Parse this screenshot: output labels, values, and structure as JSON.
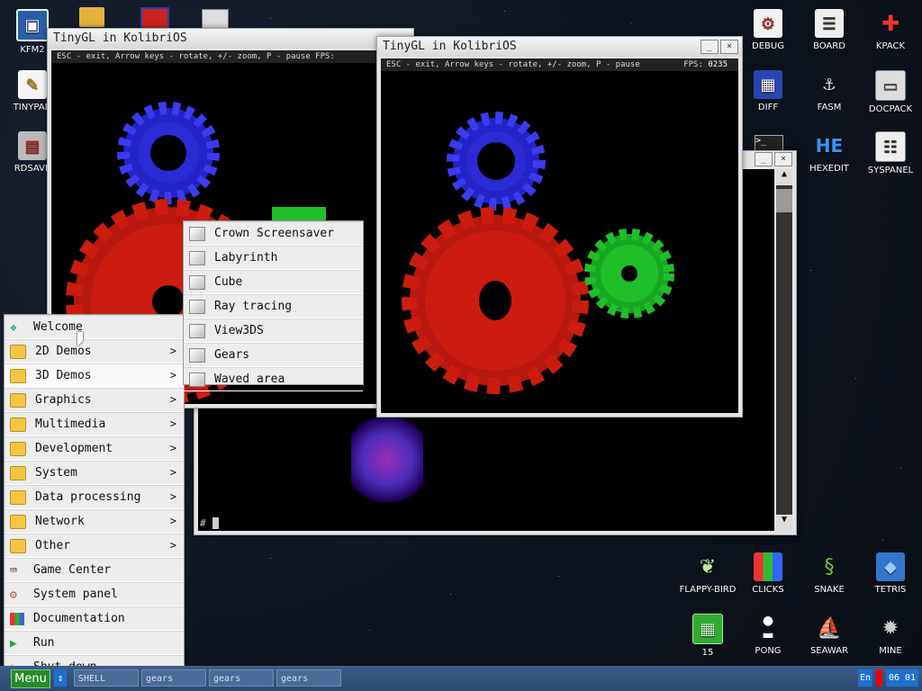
{
  "desktop_icons_left": [
    {
      "label": "KFM2",
      "icon": "floppy-icon"
    },
    {
      "label": "TINYPAD",
      "icon": "notepad-icon"
    },
    {
      "label": "RDSAVE",
      "icon": "ramdisk-icon"
    }
  ],
  "desktop_icons_right": [
    {
      "label": "DEBUG",
      "icon": "debug-icon"
    },
    {
      "label": "BOARD",
      "icon": "board-icon"
    },
    {
      "label": "KPACK",
      "icon": "wrench-icon"
    },
    {
      "label": "DIFF",
      "icon": "diff-icon"
    },
    {
      "label": "FASM",
      "icon": "fasm-icon"
    },
    {
      "label": "DOCPACK",
      "icon": "docpack-icon"
    },
    {
      "label": "HEXEDIT",
      "icon": "hexedit-icon"
    },
    {
      "label": "SYSPANEL",
      "icon": "syspanel-icon"
    }
  ],
  "desktop_icons_games": [
    {
      "label": "FLAPPY-BIRD",
      "icon": "bird-icon"
    },
    {
      "label": "CLICKS",
      "icon": "clicks-icon"
    },
    {
      "label": "SNAKE",
      "icon": "snake-icon"
    },
    {
      "label": "TETRIS",
      "icon": "tetris-icon"
    },
    {
      "label": "15",
      "icon": "puzzle15-icon"
    },
    {
      "label": "PONG",
      "icon": "pong-icon"
    },
    {
      "label": "SEAWAR",
      "icon": "ship-icon"
    },
    {
      "label": "MINE",
      "icon": "mine-icon"
    }
  ],
  "window1": {
    "title": "TinyGL in KolibriOS",
    "info": "ESC - exit, Arrow keys - rotate, +/- zoom, P - pause   FPS:"
  },
  "window2": {
    "title": "TinyGL in KolibriOS",
    "info": "ESC - exit, Arrow keys - rotate, +/- zoom, P - pause",
    "fps_label": "FPS:",
    "fps_value": "0235"
  },
  "shell": {
    "prompt": "#"
  },
  "min_label": "_",
  "close_label": "×",
  "main_menu": [
    {
      "label": "Welcome",
      "icon": "welcome-icon",
      "submenu": false
    },
    {
      "label": "2D Demos",
      "icon": "folder-icon",
      "submenu": true
    },
    {
      "label": "3D Demos",
      "icon": "folder-icon",
      "submenu": true
    },
    {
      "label": "Graphics",
      "icon": "folder-icon",
      "submenu": true
    },
    {
      "label": "Multimedia",
      "icon": "folder-icon",
      "submenu": true
    },
    {
      "label": "Development",
      "icon": "folder-icon",
      "submenu": true
    },
    {
      "label": "System",
      "icon": "folder-icon",
      "submenu": true
    },
    {
      "label": "Data processing",
      "icon": "folder-icon",
      "submenu": true
    },
    {
      "label": "Network",
      "icon": "folder-icon",
      "submenu": true
    },
    {
      "label": "Other",
      "icon": "folder-icon",
      "submenu": true
    },
    {
      "label": "Game Center",
      "icon": "gamepad-icon",
      "submenu": false
    },
    {
      "label": "System panel",
      "icon": "gears-icon",
      "submenu": false
    },
    {
      "label": "Documentation",
      "icon": "books-icon",
      "submenu": false
    },
    {
      "label": "Run",
      "icon": "play-icon",
      "submenu": false
    },
    {
      "label": "Shut down",
      "icon": "shutdown-icon",
      "submenu": false
    }
  ],
  "submenu_3d": [
    {
      "label": "Crown Screensaver"
    },
    {
      "label": "Labyrinth"
    },
    {
      "label": "Cube"
    },
    {
      "label": "Ray tracing"
    },
    {
      "label": "View3DS"
    },
    {
      "label": "Gears"
    },
    {
      "label": "Waved area"
    }
  ],
  "arrow_glyph": ">",
  "taskbar": {
    "menu_label": "Menu",
    "switch_glyph": "⇕",
    "buttons": [
      "SHELL",
      "gears",
      "gears",
      "gears"
    ],
    "lang": "En",
    "clock": "06 01"
  },
  "colors": {
    "gear_blue": "#2b2bd6",
    "gear_red": "#cc1c10",
    "gear_green": "#1fbf2a",
    "taskbar": "#2c4a73"
  }
}
